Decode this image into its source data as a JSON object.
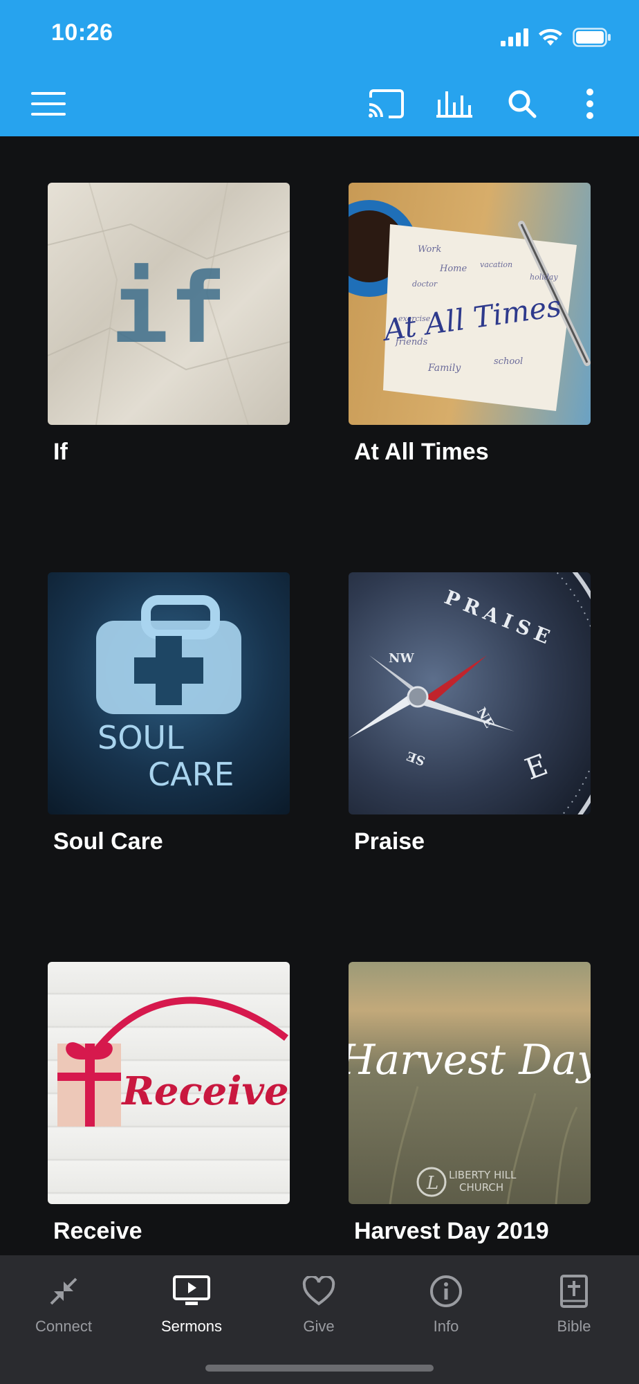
{
  "status_bar": {
    "time": "10:26"
  },
  "colors": {
    "header": "#27a3ee",
    "background": "#111214",
    "tabbar": "#2a2b2f",
    "tab_inactive": "#9a9ca1"
  },
  "app_bar": {
    "icons": [
      "menu-icon",
      "cast-icon",
      "audio-bars-icon",
      "search-icon",
      "more-vertical-icon"
    ]
  },
  "sermon_series": [
    {
      "title": "If",
      "artwork_text": "if"
    },
    {
      "title": "At All Times",
      "artwork_text": "At All Times",
      "artwork_words": [
        "Work",
        "Home",
        "vacation",
        "holiday",
        "doctor",
        "exercise",
        "friends",
        "Family",
        "school"
      ]
    },
    {
      "title": "Soul Care",
      "artwork_text": [
        "SOUL",
        "CARE"
      ]
    },
    {
      "title": "Praise",
      "artwork_text": "PRAISE",
      "compass_labels": [
        "NW",
        "NE",
        "SE",
        "E"
      ]
    },
    {
      "title": "Receive",
      "artwork_text": "Receive"
    },
    {
      "title": "Harvest Day 2019",
      "artwork_text": "Harvest Day",
      "logo_text": [
        "LIBERTY HILL",
        "CHURCH"
      ]
    }
  ],
  "tabs": [
    {
      "label": "Connect",
      "icon": "collapse-arrows-icon",
      "active": false
    },
    {
      "label": "Sermons",
      "icon": "tv-play-icon",
      "active": true
    },
    {
      "label": "Give",
      "icon": "heart-icon",
      "active": false
    },
    {
      "label": "Info",
      "icon": "info-icon",
      "active": false
    },
    {
      "label": "Bible",
      "icon": "bible-icon",
      "active": false
    }
  ]
}
